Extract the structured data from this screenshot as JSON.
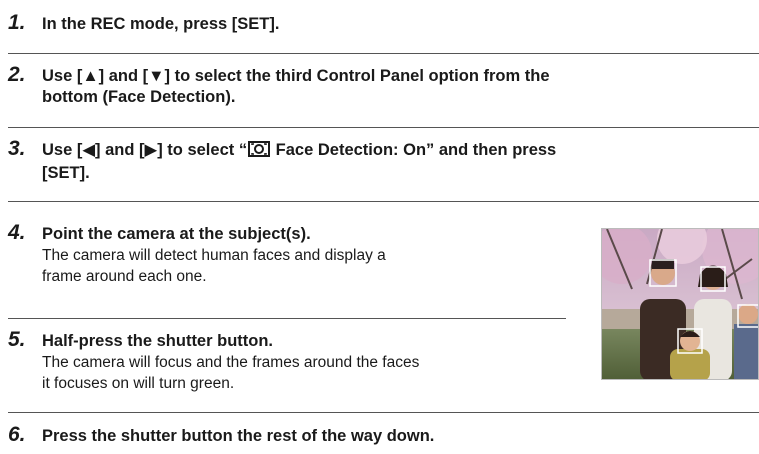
{
  "steps": [
    {
      "number": "1.",
      "title": "In the REC mode, press [SET]."
    },
    {
      "number": "2.",
      "title_lines": [
        "Use [▲] and [▼] to select the third Control Panel option from the",
        "bottom (Face Detection)."
      ]
    },
    {
      "number": "3.",
      "title_lines": [
        "Use [◀] and [▶] to select “",
        " Face Detection: On” and then press",
        "[SET]."
      ]
    },
    {
      "number": "4.",
      "title": "Point the camera at the subject(s).",
      "desc_lines": [
        "The camera will detect human faces and display a",
        "frame around each one."
      ]
    },
    {
      "number": "5.",
      "title": "Half-press the shutter button.",
      "desc_lines": [
        "The camera will focus and the frames around the faces",
        "it focuses on will turn green."
      ]
    },
    {
      "number": "6.",
      "title": "Press the shutter button the rest of the way down."
    }
  ],
  "icons": {
    "face_detection": "face-detection-icon"
  },
  "colors": {
    "rule": "#555555",
    "text": "#1a1a1a"
  }
}
